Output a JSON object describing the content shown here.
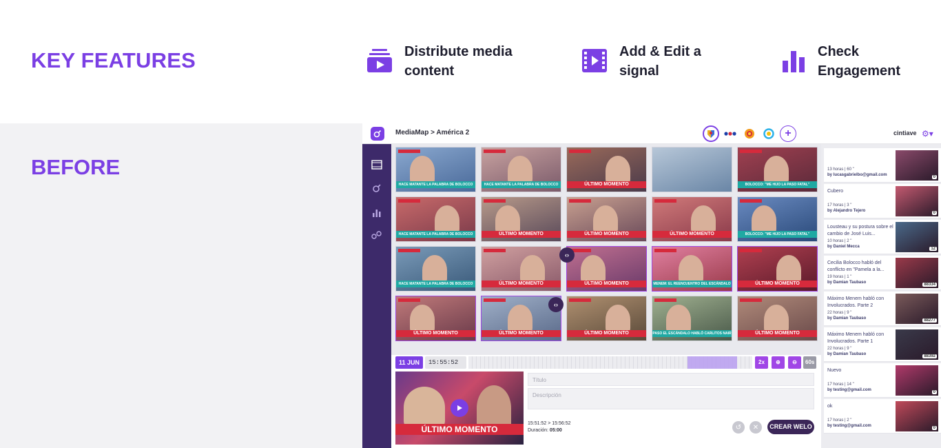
{
  "features": {
    "title": "KEY FEATURES",
    "items": [
      {
        "label": "Distribute media content",
        "icon": "media-stack-icon"
      },
      {
        "label": "Add & Edit a signal",
        "icon": "film-play-icon"
      },
      {
        "label": "Check Engagement",
        "icon": "bar-chart-icon"
      }
    ]
  },
  "before_label": "BEFORE",
  "app": {
    "breadcrumb": "MediaMap > América 2",
    "user": "cintiave",
    "thumb_banners": [
      "HACE MATANTE LA PALABRA DE BOLOCCO",
      "HACE MATANTE LA PALABRA DE BOLOCCO",
      "ÚLTIMO MOMENTO",
      "",
      "BOLOCCO: \"ME HIJO LA PASO FATAL\"",
      "HACE MATANTE LA PALABRA DE BOLOCCO",
      "ÚLTIMO MOMENTO",
      "ÚLTIMO MOMENTO",
      "ÚLTIMO MOMENTO",
      "BOLOCCO: \"ME HIJO LA PASO FATAL\"",
      "HACE MATANTE LA PALABRA DE BOLOCCO",
      "ÚLTIMO MOMENTO",
      "ÚLTIMO MOMENTO",
      "MENEM: EL REENCUENTRO DEL ESCÁNDALO",
      "ÚLTIMO MOMENTO",
      "ÚLTIMO MOMENTO",
      "ÚLTIMO MOMENTO",
      "ÚLTIMO MOMENTO",
      "PASO EL ESCÁNDALO HABLÓ CARLITOS NAIR",
      "ÚLTIMO MOMENTO"
    ],
    "timeline": {
      "date": "11 JUN",
      "time": "15:55:52",
      "buttons": [
        "2x",
        "⊕",
        "⊖",
        "60s"
      ]
    },
    "editor": {
      "title_placeholder": "Título",
      "description_placeholder": "Descripción",
      "range": "15:51:52 > 15:56:52",
      "duration_label": "Duración:",
      "duration_value": "05:00",
      "create_label": "CREAR WELO",
      "preview_banner": "ÚLTIMO MOMENTO"
    },
    "feed": [
      {
        "title": "",
        "meta": "13 horas | 60 \"",
        "author": "by lucasgabrielbo@gmail.com",
        "count": "0"
      },
      {
        "title": "Cubero",
        "meta": "17 horas | 3 \"",
        "author": "by Alejandro Tejero",
        "count": "0"
      },
      {
        "title": "Lousteau y su postura sobre el cambio de José Luis...",
        "meta": "10 horas | 2 \"",
        "author": "by Daniel Mecca",
        "count": "12"
      },
      {
        "title": "Cecilia Bolocco habló del conflicto en \"Pamela a la...",
        "meta": "19 horas | 1 \"",
        "author": "by Damian Taubaso",
        "count": "88334"
      },
      {
        "title": "Máximo Menem habló con Involucrados. Parte 2",
        "meta": "22 horas | 9 \"",
        "author": "by Damian Taubaso",
        "count": "88277"
      },
      {
        "title": "Máximo Menem habló con Involucrados. Parte 1",
        "meta": "22 horas | 9 \"",
        "author": "by Damian Taubaso",
        "count": "88392"
      },
      {
        "title": "Nuevo",
        "meta": "17 horas | 14 \"",
        "author": "by testing@gmail.com",
        "count": "0"
      },
      {
        "title": "ok",
        "meta": "17 horas | 2 \"",
        "author": "by testing@gmail.com",
        "count": "0"
      }
    ]
  }
}
